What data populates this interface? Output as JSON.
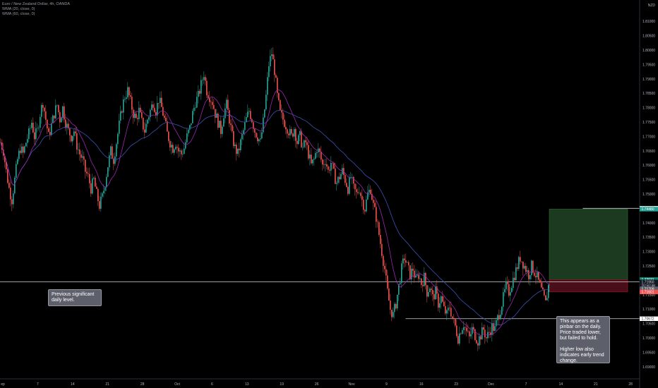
{
  "legend": {
    "symbol": "Euro / New Zealand Dollar, 4h, OANDA",
    "wma1": "WMA (20, close, 0)",
    "wma2": "WMA (60, close, 0)"
  },
  "currency": "NZD",
  "annotations": {
    "left": "Previous significant daily level.",
    "right_1": "This appears as a pinbar on the daily. Price traded lower, but failed to hold.",
    "right_2": "Higher low also indicates early trend change."
  },
  "colors": {
    "bg": "#000000",
    "up": "#26a69a",
    "down": "#ef5350",
    "wma20": "#9c27b0",
    "wma60": "#3f51b5",
    "profit_zone": "#1b3a1f",
    "loss_zone": "#4a0e1a"
  },
  "chart_data": {
    "type": "candlestick",
    "title": "Euro / New Zealand Dollar, 4h, OANDA",
    "indicators": [
      "WMA (20, close, 0)",
      "WMA (60, close, 0)"
    ],
    "ylim": [
      1.69,
      1.815
    ],
    "y_ticks": [
      "1.81000",
      "1.80500",
      "1.80000",
      "1.79500",
      "1.79000",
      "1.78500",
      "1.78000",
      "1.77500",
      "1.77000",
      "1.76500",
      "1.76000",
      "1.75500",
      "1.75000",
      "1.74500",
      "1.74000",
      "1.73500",
      "1.73000",
      "1.72500",
      "1.72000",
      "1.71500",
      "1.71000",
      "1.70500",
      "1.70000",
      "1.69500",
      "1.69000"
    ],
    "x_ticks": [
      "ep",
      "7",
      "14",
      "21",
      "28",
      "Oct",
      "6",
      "13",
      "19",
      "26",
      "Nov",
      "9",
      "16",
      "23",
      "Dec",
      "7",
      "14",
      "21",
      "28"
    ],
    "price_tags": [
      {
        "label": "1.74507",
        "value": 1.74507,
        "style": "white"
      },
      {
        "label": "1.74480",
        "value": 1.7448,
        "style": "green"
      },
      {
        "label": "1.72031",
        "value": 1.72031,
        "style": "teal"
      },
      {
        "label": "20:50:48",
        "value": 1.7182,
        "style": "dark"
      },
      {
        "label": "1.71950",
        "value": 1.7195,
        "style": "dark"
      },
      {
        "label": "1.71709",
        "value": 1.71709,
        "style": "gray"
      },
      {
        "label": "1.71601",
        "value": 1.71601,
        "style": "red"
      },
      {
        "label": "1.70672",
        "value": 1.70672,
        "style": "white"
      }
    ],
    "horizontal_levels": [
      {
        "value": 1.74507,
        "x_from_tick": "14",
        "extent": "to-axis"
      },
      {
        "value": 1.7195,
        "x_from_tick": "ep",
        "extent": "to-axis"
      },
      {
        "value": 1.70672,
        "x_from_tick": "9",
        "extent": "to-axis"
      }
    ],
    "position": {
      "entry": 1.72031,
      "target": 1.7448,
      "stop": 1.71601
    },
    "path": [
      [
        0,
        1.768
      ],
      [
        4,
        1.765
      ],
      [
        8,
        1.758
      ],
      [
        12,
        1.752
      ],
      [
        16,
        1.748
      ],
      [
        20,
        1.755
      ],
      [
        24,
        1.762
      ],
      [
        28,
        1.766
      ],
      [
        32,
        1.764
      ],
      [
        36,
        1.768
      ],
      [
        40,
        1.771
      ],
      [
        44,
        1.775
      ],
      [
        48,
        1.77
      ],
      [
        52,
        1.772
      ],
      [
        56,
        1.778
      ],
      [
        60,
        1.782
      ],
      [
        64,
        1.776
      ],
      [
        68,
        1.77
      ],
      [
        72,
        1.774
      ],
      [
        76,
        1.778
      ],
      [
        80,
        1.781
      ],
      [
        84,
        1.776
      ],
      [
        88,
        1.78
      ],
      [
        92,
        1.775
      ],
      [
        96,
        1.772
      ],
      [
        100,
        1.77
      ],
      [
        104,
        1.772
      ],
      [
        108,
        1.767
      ],
      [
        112,
        1.764
      ],
      [
        116,
        1.762
      ],
      [
        120,
        1.758
      ],
      [
        124,
        1.756
      ],
      [
        128,
        1.752
      ],
      [
        132,
        1.755
      ],
      [
        136,
        1.75
      ],
      [
        140,
        1.746
      ],
      [
        144,
        1.749
      ],
      [
        148,
        1.754
      ],
      [
        152,
        1.76
      ],
      [
        156,
        1.765
      ],
      [
        160,
        1.762
      ],
      [
        164,
        1.768
      ],
      [
        168,
        1.774
      ],
      [
        172,
        1.78
      ],
      [
        176,
        1.784
      ],
      [
        180,
        1.786
      ],
      [
        184,
        1.782
      ],
      [
        188,
        1.778
      ],
      [
        192,
        1.776
      ],
      [
        196,
        1.779
      ],
      [
        200,
        1.775
      ],
      [
        204,
        1.772
      ],
      [
        208,
        1.776
      ],
      [
        212,
        1.779
      ],
      [
        216,
        1.782
      ],
      [
        220,
        1.779
      ],
      [
        224,
        1.783
      ],
      [
        228,
        1.78
      ],
      [
        232,
        1.776
      ],
      [
        236,
        1.771
      ],
      [
        240,
        1.768
      ],
      [
        244,
        1.766
      ],
      [
        248,
        1.768
      ],
      [
        252,
        1.765
      ],
      [
        256,
        1.764
      ],
      [
        260,
        1.766
      ],
      [
        264,
        1.77
      ],
      [
        268,
        1.773
      ],
      [
        272,
        1.778
      ],
      [
        276,
        1.782
      ],
      [
        280,
        1.784
      ],
      [
        284,
        1.788
      ],
      [
        288,
        1.792
      ],
      [
        292,
        1.786
      ],
      [
        296,
        1.784
      ],
      [
        300,
        1.782
      ],
      [
        304,
        1.778
      ],
      [
        308,
        1.775
      ],
      [
        312,
        1.772
      ],
      [
        316,
        1.778
      ],
      [
        320,
        1.781
      ],
      [
        324,
        1.776
      ],
      [
        328,
        1.77
      ],
      [
        332,
        1.766
      ],
      [
        336,
        1.764
      ],
      [
        340,
        1.768
      ],
      [
        344,
        1.772
      ],
      [
        348,
        1.776
      ],
      [
        352,
        1.779
      ],
      [
        356,
        1.776
      ],
      [
        360,
        1.772
      ],
      [
        364,
        1.77
      ],
      [
        368,
        1.768
      ],
      [
        372,
        1.775
      ],
      [
        376,
        1.784
      ],
      [
        380,
        1.795
      ],
      [
        384,
        1.799
      ],
      [
        388,
        1.793
      ],
      [
        392,
        1.784
      ],
      [
        396,
        1.778
      ],
      [
        400,
        1.776
      ],
      [
        404,
        1.774
      ],
      [
        408,
        1.772
      ],
      [
        412,
        1.77
      ],
      [
        416,
        1.773
      ],
      [
        420,
        1.768
      ],
      [
        424,
        1.77
      ],
      [
        428,
        1.766
      ],
      [
        432,
        1.768
      ],
      [
        436,
        1.764
      ],
      [
        440,
        1.76
      ],
      [
        444,
        1.762
      ],
      [
        448,
        1.766
      ],
      [
        452,
        1.764
      ],
      [
        456,
        1.76
      ],
      [
        460,
        1.762
      ],
      [
        464,
        1.758
      ],
      [
        468,
        1.761
      ],
      [
        472,
        1.757
      ],
      [
        476,
        1.754
      ],
      [
        480,
        1.756
      ],
      [
        484,
        1.758
      ],
      [
        488,
        1.755
      ],
      [
        492,
        1.752
      ],
      [
        496,
        1.756
      ],
      [
        500,
        1.752
      ],
      [
        504,
        1.75
      ],
      [
        508,
        1.752
      ],
      [
        512,
        1.748
      ],
      [
        516,
        1.745
      ],
      [
        520,
        1.75
      ],
      [
        524,
        1.752
      ],
      [
        528,
        1.746
      ],
      [
        532,
        1.742
      ],
      [
        536,
        1.736
      ],
      [
        540,
        1.73
      ],
      [
        544,
        1.724
      ],
      [
        548,
        1.716
      ],
      [
        552,
        1.71
      ],
      [
        556,
        1.708
      ],
      [
        560,
        1.712
      ],
      [
        564,
        1.718
      ],
      [
        568,
        1.724
      ],
      [
        572,
        1.728
      ],
      [
        576,
        1.725
      ],
      [
        580,
        1.722
      ],
      [
        584,
        1.724
      ],
      [
        588,
        1.72
      ],
      [
        592,
        1.722
      ],
      [
        596,
        1.719
      ],
      [
        600,
        1.721
      ],
      [
        604,
        1.716
      ],
      [
        608,
        1.718
      ],
      [
        612,
        1.714
      ],
      [
        616,
        1.716
      ],
      [
        620,
        1.712
      ],
      [
        624,
        1.714
      ],
      [
        628,
        1.71
      ],
      [
        632,
        1.708
      ],
      [
        636,
        1.711
      ],
      [
        640,
        1.707
      ],
      [
        644,
        1.704
      ],
      [
        648,
        1.7
      ],
      [
        652,
        1.703
      ],
      [
        656,
        1.705
      ],
      [
        660,
        1.702
      ],
      [
        664,
        1.7
      ],
      [
        668,
        1.703
      ],
      [
        672,
        1.701
      ],
      [
        676,
        1.699
      ],
      [
        680,
        1.701
      ],
      [
        684,
        1.703
      ],
      [
        688,
        1.7
      ],
      [
        692,
        1.702
      ],
      [
        696,
        1.704
      ],
      [
        700,
        1.703
      ],
      [
        704,
        1.707
      ],
      [
        708,
        1.71
      ],
      [
        712,
        1.714
      ],
      [
        716,
        1.718
      ],
      [
        720,
        1.716
      ],
      [
        724,
        1.719
      ],
      [
        728,
        1.722
      ],
      [
        732,
        1.725
      ],
      [
        736,
        1.728
      ],
      [
        740,
        1.726
      ],
      [
        744,
        1.724
      ],
      [
        748,
        1.722
      ],
      [
        752,
        1.725
      ],
      [
        756,
        1.723
      ],
      [
        760,
        1.721
      ],
      [
        764,
        1.718
      ],
      [
        768,
        1.715
      ],
      [
        772,
        1.712
      ],
      [
        776,
        1.718
      ],
      [
        778,
        1.721
      ]
    ]
  }
}
